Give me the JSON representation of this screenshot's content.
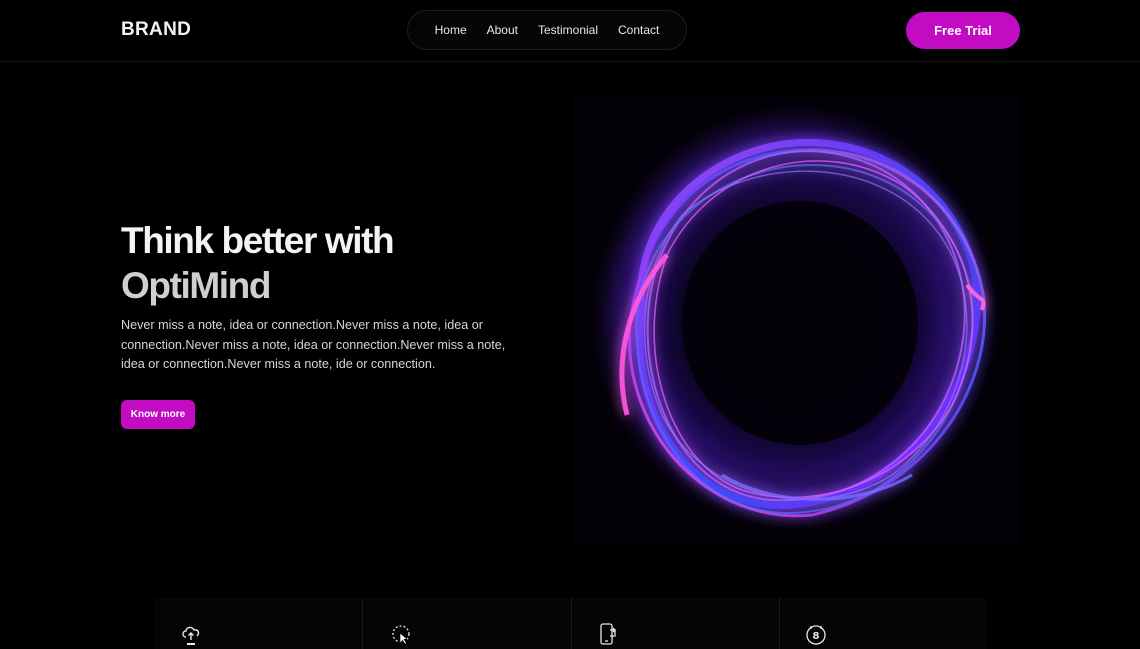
{
  "header": {
    "brand": "BRAND",
    "nav": [
      {
        "label": "Home"
      },
      {
        "label": "About"
      },
      {
        "label": "Testimonial"
      },
      {
        "label": "Contact"
      }
    ],
    "cta_label": "Free Trial"
  },
  "hero": {
    "title_line1": "Think better with",
    "title_line2": "OptiMind",
    "description": "Never miss a note, idea or connection.Never miss a note, idea or connection.Never miss a note, idea or connection.Never miss a note, idea or connection.Never miss a note, ide or connection.",
    "button_label": "Know more"
  },
  "features": [
    {
      "icon": "cloud-upload-icon"
    },
    {
      "icon": "cursor-click-icon"
    },
    {
      "icon": "mobile-sync-icon"
    },
    {
      "icon": "calendar-badge-icon"
    }
  ],
  "colors": {
    "accent": "#c20bc2",
    "background": "#000000",
    "text": "#f4f4f4"
  }
}
